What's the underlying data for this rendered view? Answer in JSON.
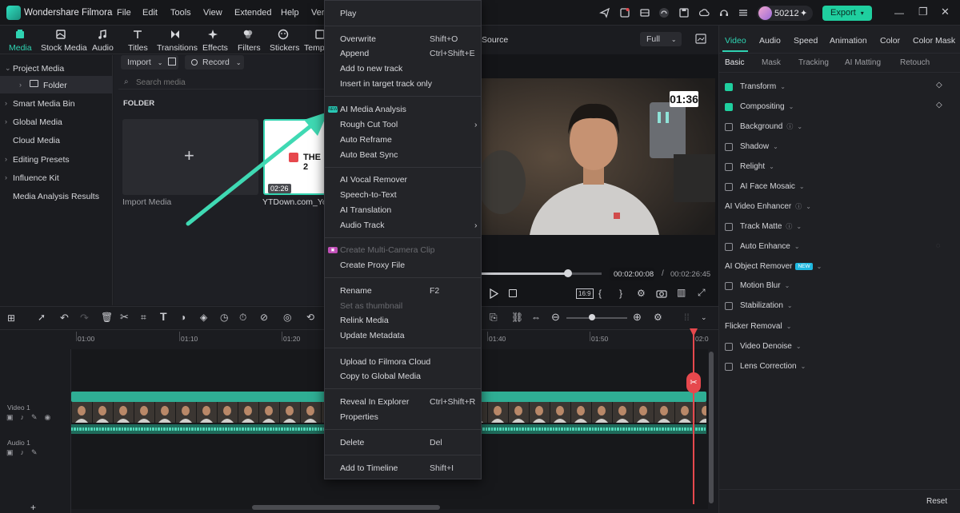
{
  "app": {
    "name": "Wondershare Filmora",
    "credits": "50212",
    "export_label": "Export"
  },
  "menubar": [
    "File",
    "Edit",
    "Tools",
    "View",
    "Extended",
    "Help",
    "Vers"
  ],
  "media_tabs": [
    "Media",
    "Stock Media",
    "Audio",
    "Titles",
    "Transitions",
    "Effects",
    "Filters",
    "Stickers",
    "Templ"
  ],
  "sidebar": {
    "items": [
      "Project Media",
      "Folder",
      "Smart Media Bin",
      "Global Media",
      "Cloud Media",
      "Editing Presets",
      "Influence Kit",
      "Media Analysis Results"
    ]
  },
  "media": {
    "import_label": "Import",
    "record_label": "Record",
    "search_placeholder": "Search media",
    "folder_heading": "FOLDER",
    "import_media": "Import Media",
    "clip_name": "YTDown.com_YouT",
    "clip_duration": "02:26",
    "thumb_text": "THE 2"
  },
  "context_menu": [
    {
      "label": "Play",
      "shortcut": ""
    },
    {
      "label": "Overwrite",
      "shortcut": "Shift+O"
    },
    {
      "label": "Append",
      "shortcut": "Ctrl+Shift+E"
    },
    {
      "label": "Add to new track",
      "shortcut": ""
    },
    {
      "label": "Insert in target track only",
      "shortcut": ""
    },
    {
      "label": "AI Media Analysis",
      "shortcut": "",
      "badge": "NEW"
    },
    {
      "label": "Rough Cut Tool",
      "shortcut": "",
      "submenu": true
    },
    {
      "label": "Auto Reframe",
      "shortcut": ""
    },
    {
      "label": "Auto Beat Sync",
      "shortcut": ""
    },
    {
      "label": "AI Vocal Remover",
      "shortcut": ""
    },
    {
      "label": "Speech-to-Text",
      "shortcut": ""
    },
    {
      "label": "AI Translation",
      "shortcut": ""
    },
    {
      "label": "Audio Track",
      "shortcut": "",
      "submenu": true
    },
    {
      "label": "Create Multi-Camera Clip",
      "shortcut": "",
      "disabled": true
    },
    {
      "label": "Create Proxy File",
      "shortcut": ""
    },
    {
      "label": "Rename",
      "shortcut": "F2"
    },
    {
      "label": "Set as thumbnail",
      "shortcut": "",
      "disabled": true
    },
    {
      "label": "Relink Media",
      "shortcut": ""
    },
    {
      "label": "Update Metadata",
      "shortcut": ""
    },
    {
      "label": "Upload to Filmora Cloud",
      "shortcut": ""
    },
    {
      "label": "Copy to Global Media",
      "shortcut": ""
    },
    {
      "label": "Reveal In Explorer",
      "shortcut": "Ctrl+Shift+R"
    },
    {
      "label": "Properties",
      "shortcut": ""
    },
    {
      "label": "Delete",
      "shortcut": "Del"
    },
    {
      "label": "Add to Timeline",
      "shortcut": "Shift+I"
    }
  ],
  "preview": {
    "source_label": "Source",
    "quality": "Full",
    "current_time": "00:02:00:08",
    "total_time": "00:02:26:45",
    "overlay_timer": "01:36",
    "playback_progress": 0.72
  },
  "right_panel": {
    "tabs": [
      "Video",
      "Audio",
      "Speed",
      "Animation",
      "Color",
      "Color Mask"
    ],
    "subtabs": [
      "Basic",
      "Mask",
      "Tracking",
      "AI Matting",
      "Retouch"
    ],
    "properties": [
      {
        "label": "Transform",
        "checked": true
      },
      {
        "label": "Compositing",
        "checked": true
      },
      {
        "label": "Background",
        "checked": false
      },
      {
        "label": "Shadow",
        "checked": false
      },
      {
        "label": "Relight",
        "checked": false
      },
      {
        "label": "AI Face Mosaic",
        "checked": false
      },
      {
        "label": "AI Video Enhancer",
        "section": true
      },
      {
        "label": "Track Matte",
        "checked": false
      },
      {
        "label": "Auto Enhance",
        "checked": false
      },
      {
        "label": "AI Object Remover",
        "section": true,
        "badge": "NEW"
      },
      {
        "label": "Motion Blur",
        "checked": false
      },
      {
        "label": "Stabilization",
        "checked": false
      },
      {
        "label": "Flicker Removal",
        "section": true
      },
      {
        "label": "Video Denoise",
        "checked": false
      },
      {
        "label": "Lens Correction",
        "checked": false
      }
    ],
    "reset_label": "Reset"
  },
  "timeline": {
    "ruler": [
      "01:00",
      "01:10",
      "01:20",
      "01:40",
      "01:50",
      "02:0"
    ],
    "video_track": "Video 1",
    "audio_track": "Audio 1"
  },
  "colors": {
    "accent": "#1fcf9f",
    "playhead": "#e6484d",
    "arrow": "#3fd9b3"
  }
}
